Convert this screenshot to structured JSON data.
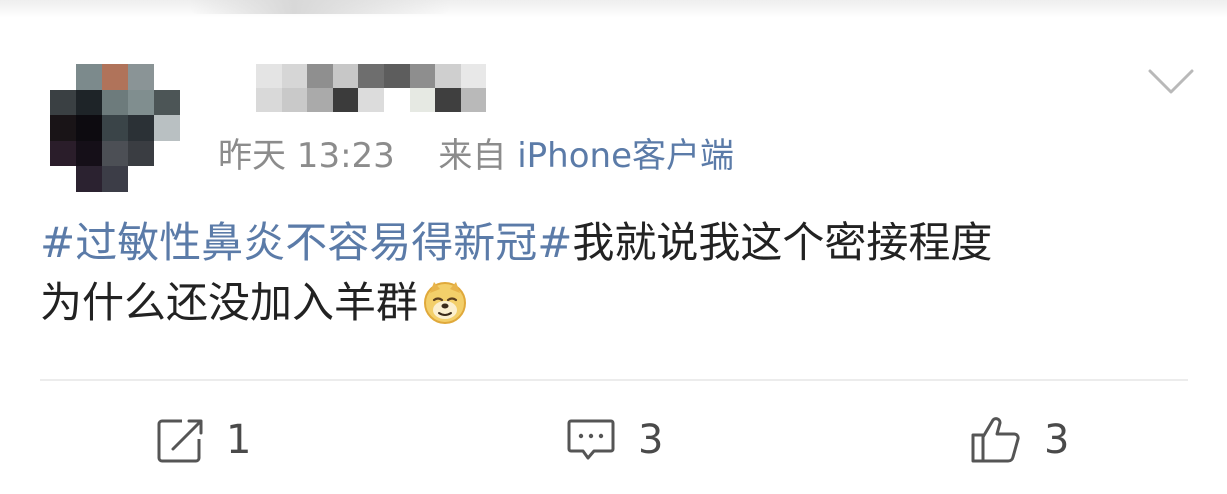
{
  "post": {
    "timestamp": "昨天 13:23",
    "source_prefix": "来自",
    "source_app": "iPhone客户端",
    "topic": "#过敏性鼻炎不容易得新冠#",
    "text_line1": "我就说我这个密接程度",
    "text_line2": "为什么还没加入羊群",
    "emoji": "doge"
  },
  "actions": {
    "repost_count": "1",
    "comment_count": "3",
    "like_count": "3"
  },
  "icons": {
    "menu": "chevron-down-icon",
    "repost": "repost-icon",
    "comment": "comment-icon",
    "like": "thumbs-up-icon"
  },
  "colors": {
    "link_blue": "#5b7ba8",
    "meta_gray": "#8c8c8c",
    "text": "#222222"
  }
}
